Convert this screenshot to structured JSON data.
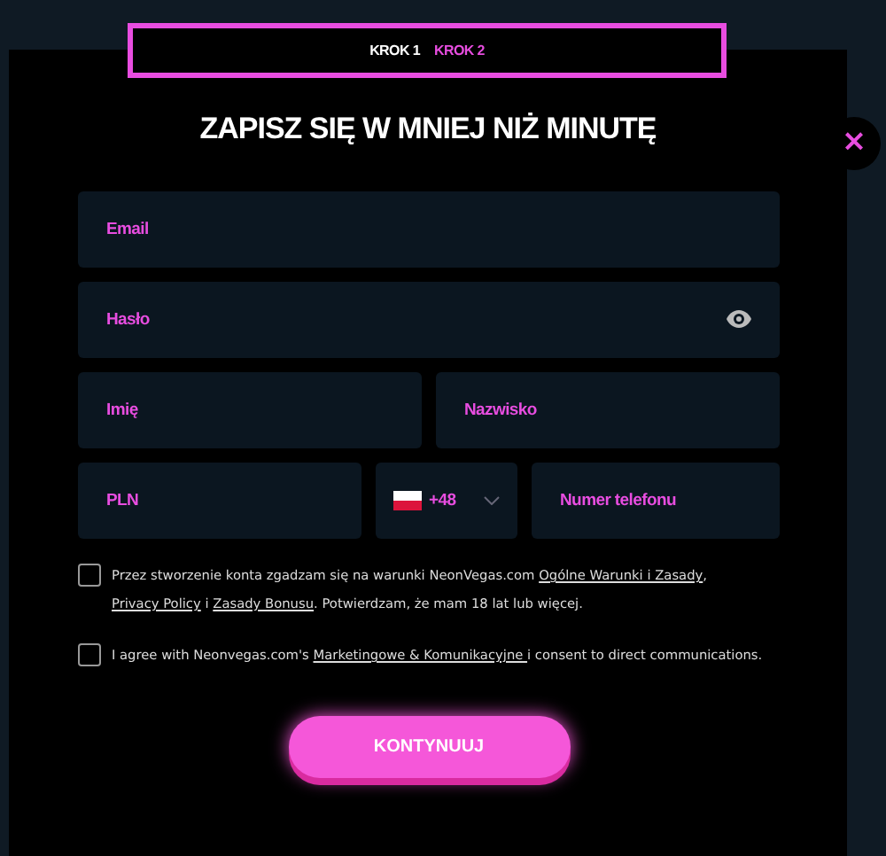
{
  "steps": [
    {
      "label": "KROK 1",
      "selected": false
    },
    {
      "label": "KROK 2",
      "selected": true
    }
  ],
  "title": "ZAPISZ SIĘ W MNIEJ NIŻ MINUTĘ",
  "close": "×",
  "fields": {
    "email": {
      "placeholder": "Email"
    },
    "password": {
      "placeholder": "Hasło"
    },
    "first_name": {
      "placeholder": "Imię"
    },
    "last_name": {
      "placeholder": "Nazwisko"
    },
    "currency": {
      "value": "PLN"
    },
    "dial_code": {
      "value": "+48"
    },
    "phone": {
      "placeholder": "Numer telefonu"
    }
  },
  "consents": [
    {
      "checked": false,
      "parts": [
        {
          "kind": "text",
          "text": "Przez stworzenie konta zgadzam się na warunki NeonVegas.com "
        },
        {
          "kind": "link",
          "text": "Ogólne Warunki i Zasady"
        },
        {
          "kind": "text",
          "text": ", "
        },
        {
          "kind": "link",
          "text": "Privacy Policy"
        },
        {
          "kind": "text",
          "text": " i "
        },
        {
          "kind": "link",
          "text": "Zasady Bonusu"
        },
        {
          "kind": "text",
          "text": ". Potwierdzam, że mam 18 lat lub więcej."
        }
      ]
    },
    {
      "checked": false,
      "parts": [
        {
          "kind": "text",
          "text": "I agree with Neonvegas.com's "
        },
        {
          "kind": "link",
          "text": "Marketingowe & Komunikacyjne "
        },
        {
          "kind": "text",
          "text": "i consent to direct communications."
        }
      ]
    }
  ],
  "submit": "KONTYNUUJ"
}
